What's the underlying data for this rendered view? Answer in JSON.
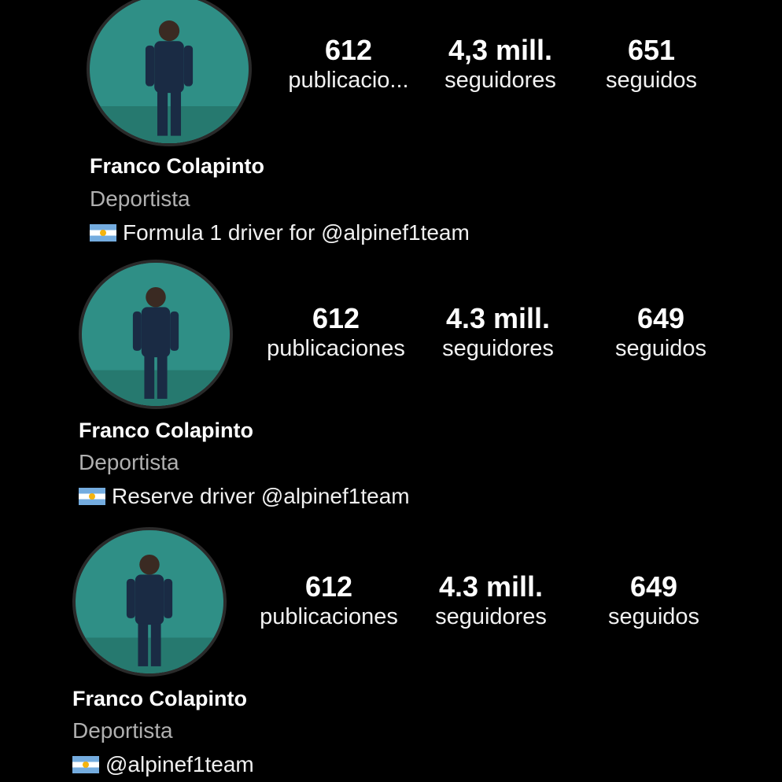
{
  "profiles": [
    {
      "avatar_icon": "profile-photo",
      "stats": [
        {
          "value": "612",
          "label": "publicacio..."
        },
        {
          "value": "4,3 mill.",
          "label": "seguidores"
        },
        {
          "value": "651",
          "label": "seguidos"
        }
      ],
      "name": "Franco Colapinto",
      "category": "Deportista",
      "bio_flag": "argentina-flag-icon",
      "bio": "Formula 1 driver for @alpinef1team"
    },
    {
      "avatar_icon": "profile-photo",
      "stats": [
        {
          "value": "612",
          "label": "publicaciones"
        },
        {
          "value": "4.3 mill.",
          "label": "seguidores"
        },
        {
          "value": "649",
          "label": "seguidos"
        }
      ],
      "name": "Franco Colapinto",
      "category": "Deportista",
      "bio_flag": "argentina-flag-icon",
      "bio": "Reserve driver @alpinef1team"
    },
    {
      "avatar_icon": "profile-photo",
      "stats": [
        {
          "value": "612",
          "label": "publicaciones"
        },
        {
          "value": "4.3 mill.",
          "label": "seguidores"
        },
        {
          "value": "649",
          "label": "seguidos"
        }
      ],
      "name": "Franco Colapinto",
      "category": "Deportista",
      "bio_flag": "argentina-flag-icon",
      "bio": "@alpinef1team"
    }
  ],
  "colors": {
    "background": "#000000",
    "avatar_bg": "#2f8f86",
    "text_primary": "#ffffff",
    "text_secondary": "#b0b0b0"
  }
}
